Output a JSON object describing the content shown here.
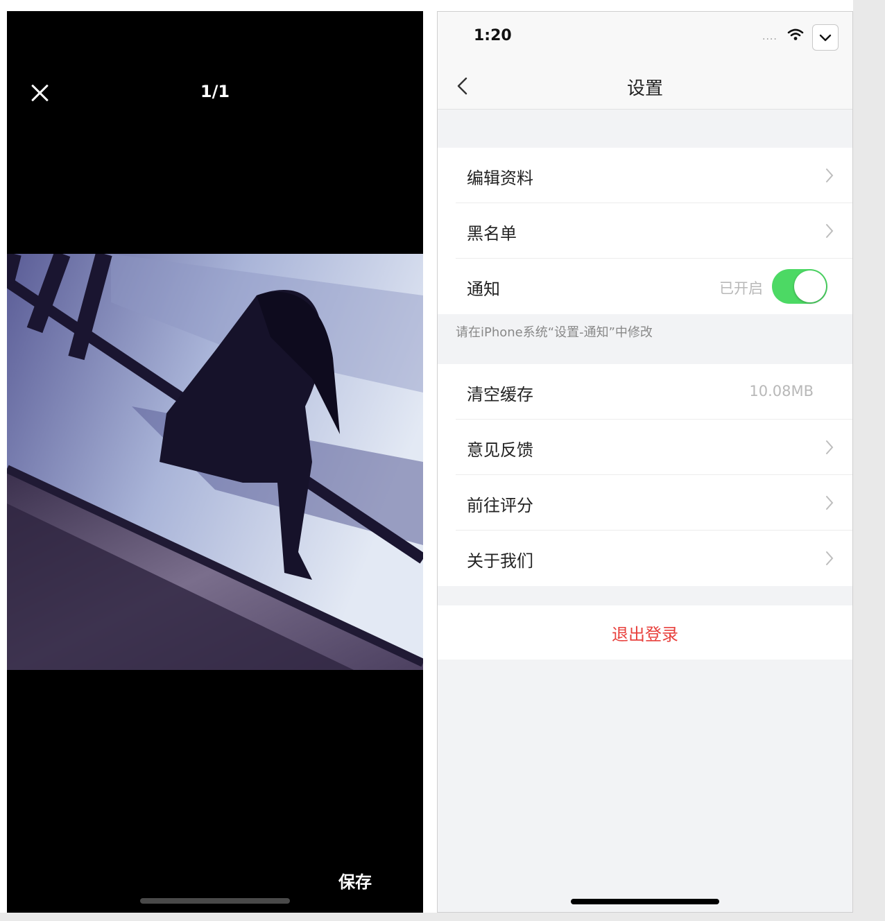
{
  "viewer": {
    "counter": "1/1",
    "save_label": "保存"
  },
  "settings": {
    "status_time": "1:20",
    "status_signal": "....",
    "nav_title": "设置",
    "group1": [
      {
        "label": "编辑资料"
      },
      {
        "label": "黑名单"
      },
      {
        "label": "通知",
        "status": "已开启",
        "toggle_on": true
      }
    ],
    "hint": "请在iPhone系统“设置-通知”中修改",
    "group2": [
      {
        "label": "清空缓存",
        "value": "10.08MB"
      },
      {
        "label": "意见反馈"
      },
      {
        "label": "前往评分"
      },
      {
        "label": "关于我们"
      }
    ],
    "logout_label": "退出登录"
  },
  "colors": {
    "toggle_on": "#4cd964",
    "logout": "#e8413d",
    "viewer_bg": "#000000",
    "settings_bg": "#f2f3f5"
  },
  "icons": [
    "close-icon",
    "wifi-icon",
    "chevron-down-icon",
    "back-icon",
    "chevron-right-icon"
  ]
}
